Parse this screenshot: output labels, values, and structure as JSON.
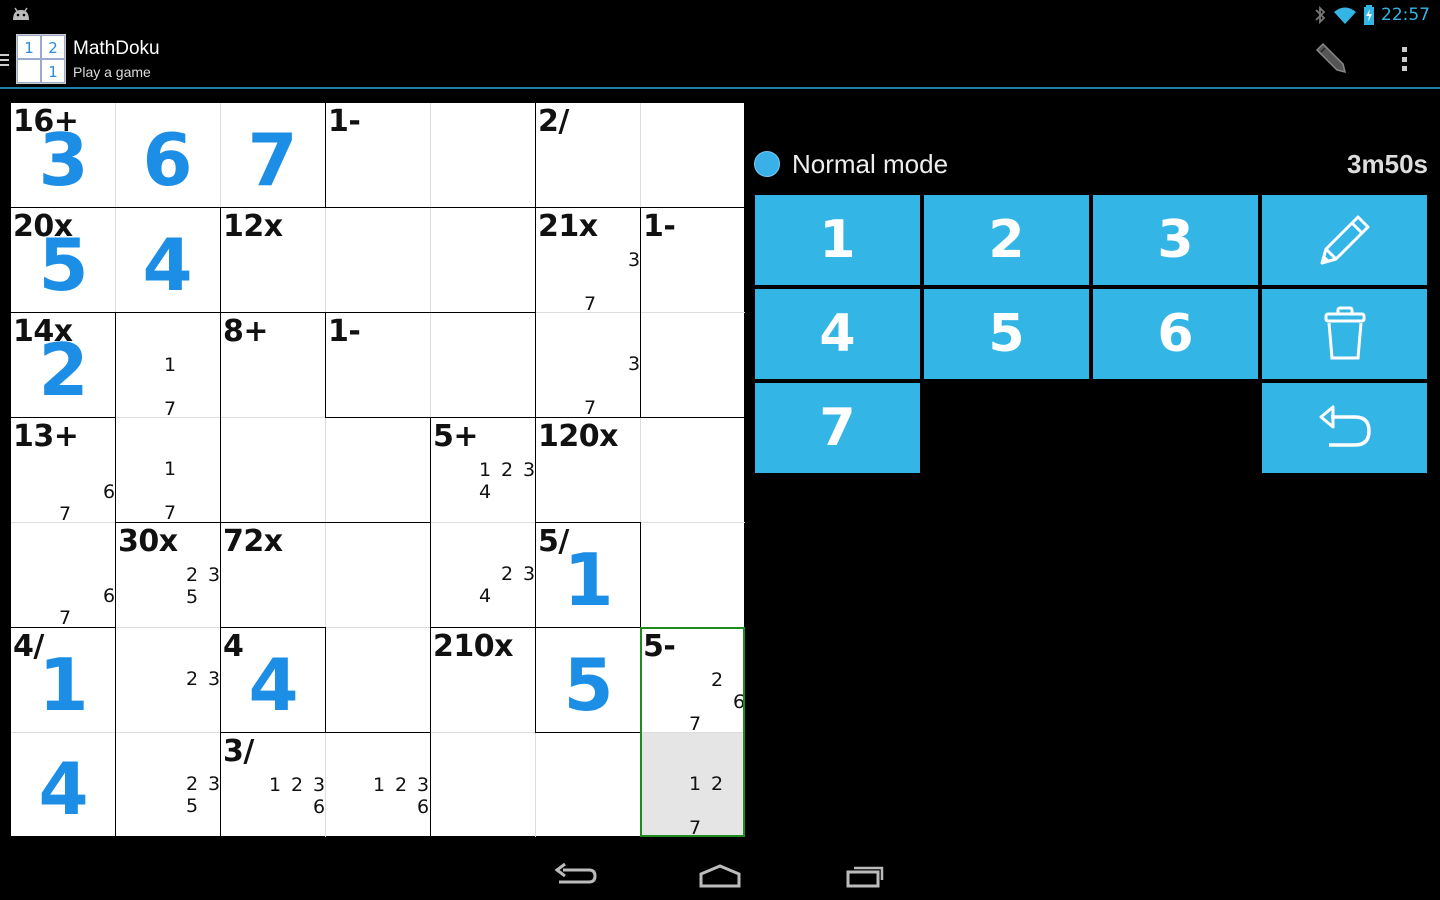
{
  "status_bar": {
    "time": "22:57",
    "icons": [
      "android-icon",
      "bluetooth-icon",
      "wifi-icon",
      "battery-charging-icon"
    ]
  },
  "action_bar": {
    "title": "MathDoku",
    "subtitle": "Play a game",
    "app_icon_digits": [
      "1",
      "2",
      "",
      "1"
    ],
    "actions": [
      "pencil-icon",
      "overflow-menu-icon"
    ]
  },
  "mode": {
    "label": "Normal mode",
    "indicator_color": "#3ab0ea"
  },
  "timer": "3m50s",
  "keypad": {
    "color": "#33b5e5",
    "keys": [
      "1",
      "2",
      "3",
      "4",
      "5",
      "6",
      "7"
    ],
    "tools": [
      "pencil-icon",
      "trash-icon",
      "undo-icon"
    ]
  },
  "grid": {
    "size": 7,
    "cages": [
      [
        "16+",
        "",
        "",
        "1-",
        "",
        "2/",
        ""
      ],
      [
        "20x",
        "",
        "12x",
        "",
        "",
        "21x",
        "1-"
      ],
      [
        "14x",
        "",
        "8+",
        "1-",
        "",
        "",
        ""
      ],
      [
        "13+",
        "",
        "",
        "",
        "5+",
        "120x",
        ""
      ],
      [
        "",
        "30x",
        "72x",
        "",
        "",
        "5/",
        ""
      ],
      [
        "4/",
        "",
        "4",
        "",
        "210x",
        "",
        "5-"
      ],
      [
        "",
        "",
        "3/",
        "",
        "",
        "",
        ""
      ]
    ],
    "values": [
      [
        "3",
        "6",
        "7",
        "",
        "",
        "",
        ""
      ],
      [
        "5",
        "4",
        "",
        "",
        "",
        "",
        ""
      ],
      [
        "2",
        "",
        "",
        "",
        "",
        "",
        ""
      ],
      [
        "",
        "",
        "",
        "",
        "",
        "",
        ""
      ],
      [
        "",
        "",
        "",
        "",
        "",
        "1",
        ""
      ],
      [
        "1",
        "",
        "4",
        "",
        "",
        "5",
        ""
      ],
      [
        "4",
        "",
        "",
        "",
        "",
        "",
        ""
      ]
    ],
    "notes": [
      [
        [],
        [],
        [],
        [],
        [],
        [],
        []
      ],
      [
        [],
        [],
        [],
        [],
        [],
        [
          3,
          7
        ],
        []
      ],
      [
        [],
        [
          1,
          7
        ],
        [],
        [],
        [],
        [
          3,
          7
        ],
        []
      ],
      [
        [
          6,
          7
        ],
        [
          1,
          7
        ],
        [],
        [],
        [
          1,
          2,
          3,
          4
        ],
        [],
        []
      ],
      [
        [
          6,
          7
        ],
        [
          2,
          3,
          5
        ],
        [],
        [],
        [
          2,
          3,
          4
        ],
        [],
        []
      ],
      [
        [],
        [
          2,
          3
        ],
        [],
        [],
        [],
        [],
        [
          2,
          6,
          7
        ]
      ],
      [
        [],
        [
          2,
          3,
          5
        ],
        [
          1,
          2,
          3,
          6
        ],
        [
          1,
          2,
          3,
          6
        ],
        [],
        [],
        [
          1,
          2,
          7
        ]
      ]
    ],
    "selected_cell": [
      6,
      6
    ],
    "selected_cage_color": "#1f8b1f",
    "value_color": "#1d8ee6"
  },
  "nav_bar": {
    "buttons": [
      "back-icon",
      "home-icon",
      "recent-apps-icon"
    ]
  }
}
